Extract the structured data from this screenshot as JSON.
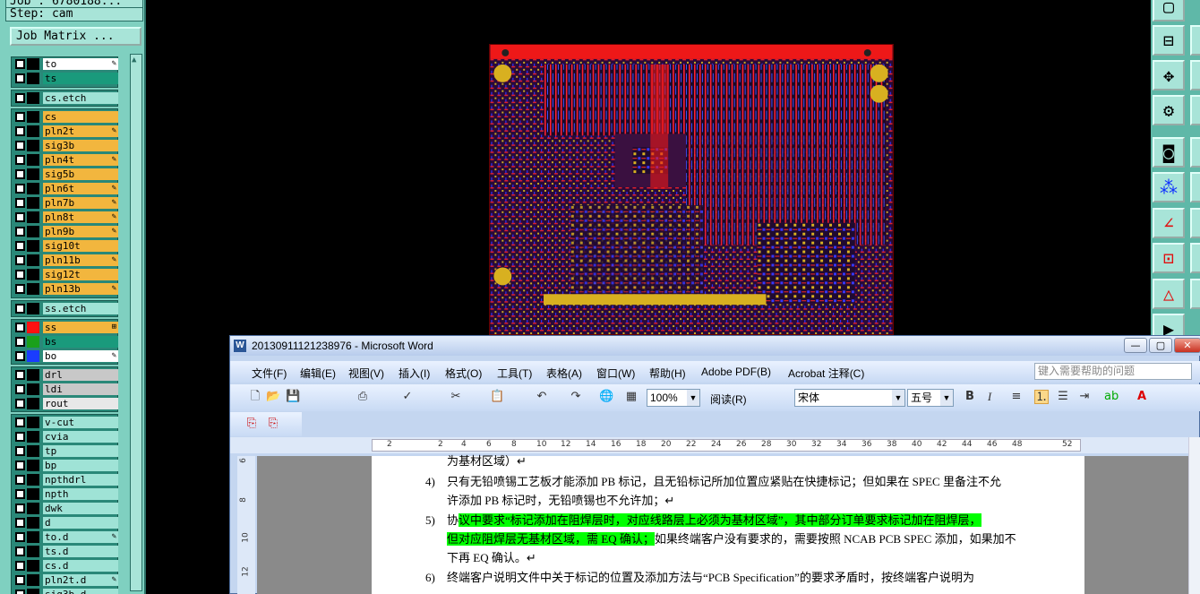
{
  "left_panel": {
    "header_top": "Job : 6780188...",
    "step": "Step: cam",
    "job_matrix_button": "Job Matrix ..."
  },
  "layers": [
    {
      "name": "to",
      "color": "#ffffff",
      "swatch": "#000000",
      "mark": "✎"
    },
    {
      "name": "ts",
      "color": "#1a9a7c",
      "swatch": "#000000",
      "mark": ""
    },
    {
      "name": "cs.etch",
      "color": "#9fe3d6",
      "swatch": "#000000",
      "mark": ""
    },
    {
      "name": "cs",
      "color": "#f2b63e",
      "swatch": "#000000",
      "mark": ""
    },
    {
      "name": "pln2t",
      "color": "#f2b63e",
      "swatch": "#000000",
      "mark": "✎"
    },
    {
      "name": "sig3b",
      "color": "#f2b63e",
      "swatch": "#000000",
      "mark": ""
    },
    {
      "name": "pln4t",
      "color": "#f2b63e",
      "swatch": "#000000",
      "mark": "✎"
    },
    {
      "name": "sig5b",
      "color": "#f2b63e",
      "swatch": "#000000",
      "mark": ""
    },
    {
      "name": "pln6t",
      "color": "#f2b63e",
      "swatch": "#000000",
      "mark": "✎"
    },
    {
      "name": "pln7b",
      "color": "#f2b63e",
      "swatch": "#000000",
      "mark": "✎"
    },
    {
      "name": "pln8t",
      "color": "#f2b63e",
      "swatch": "#000000",
      "mark": "✎"
    },
    {
      "name": "pln9b",
      "color": "#f2b63e",
      "swatch": "#000000",
      "mark": "✎"
    },
    {
      "name": "sig10t",
      "color": "#f2b63e",
      "swatch": "#000000",
      "mark": ""
    },
    {
      "name": "pln11b",
      "color": "#f2b63e",
      "swatch": "#000000",
      "mark": "✎"
    },
    {
      "name": "sig12t",
      "color": "#f2b63e",
      "swatch": "#000000",
      "mark": ""
    },
    {
      "name": "pln13b",
      "color": "#f2b63e",
      "swatch": "#000000",
      "mark": "✎"
    },
    {
      "name": "ss.etch",
      "color": "#9fe3d6",
      "swatch": "#000000",
      "mark": ""
    },
    {
      "name": "ss",
      "color": "#f2b63e",
      "swatch": "#ff1111",
      "mark": "⊞"
    },
    {
      "name": "bs",
      "color": "#1a9a7c",
      "swatch": "#1aa01a",
      "mark": ""
    },
    {
      "name": "bo",
      "color": "#ffffff",
      "swatch": "#1a3cff",
      "mark": "✎"
    },
    {
      "name": "drl",
      "color": "#c8c8c8",
      "swatch": "#000000",
      "mark": ""
    },
    {
      "name": "ldi",
      "color": "#c8c8c8",
      "swatch": "#000000",
      "mark": ""
    },
    {
      "name": "rout",
      "color": "#e8e8e8",
      "swatch": "#000000",
      "mark": ""
    },
    {
      "name": "v-cut",
      "color": "#9fe3d6",
      "swatch": "#000000",
      "mark": ""
    },
    {
      "name": "cvia",
      "color": "#9fe3d6",
      "swatch": "#000000",
      "mark": ""
    },
    {
      "name": "tp",
      "color": "#9fe3d6",
      "swatch": "#000000",
      "mark": ""
    },
    {
      "name": "bp",
      "color": "#9fe3d6",
      "swatch": "#000000",
      "mark": ""
    },
    {
      "name": "npthdrl",
      "color": "#9fe3d6",
      "swatch": "#000000",
      "mark": ""
    },
    {
      "name": "npth",
      "color": "#9fe3d6",
      "swatch": "#000000",
      "mark": ""
    },
    {
      "name": "dwk",
      "color": "#9fe3d6",
      "swatch": "#000000",
      "mark": ""
    },
    {
      "name": "d",
      "color": "#9fe3d6",
      "swatch": "#000000",
      "mark": ""
    },
    {
      "name": "to.d",
      "color": "#9fe3d6",
      "swatch": "#000000",
      "mark": "✎"
    },
    {
      "name": "ts.d",
      "color": "#9fe3d6",
      "swatch": "#000000",
      "mark": ""
    },
    {
      "name": "cs.d",
      "color": "#9fe3d6",
      "swatch": "#000000",
      "mark": ""
    },
    {
      "name": "pln2t.d",
      "color": "#9fe3d6",
      "swatch": "#000000",
      "mark": "✎"
    },
    {
      "name": "sig3b.d",
      "color": "#9fe3d6",
      "swatch": "#000000",
      "mark": ""
    }
  ],
  "word": {
    "title": "20130911121238976 - Microsoft Word",
    "menus": [
      "文件(F)",
      "编辑(E)",
      "视图(V)",
      "插入(I)",
      "格式(O)",
      "工具(T)",
      "表格(A)",
      "窗口(W)",
      "帮助(H)",
      "Adobe PDF(B)",
      "Acrobat 注释(C)"
    ],
    "help_placeholder": "键入需要帮助的问题",
    "zoom": "100%",
    "read_button": "阅读(R)",
    "font": "宋体",
    "font_size": "五号",
    "ruler_ticks": [
      "2",
      "2",
      "4",
      "6",
      "8",
      "10",
      "12",
      "14",
      "16",
      "18",
      "20",
      "22",
      "24",
      "26",
      "28",
      "30",
      "32",
      "34",
      "36",
      "38",
      "40",
      "42",
      "44",
      "46",
      "48",
      "52"
    ],
    "vruler_ticks": [
      "6",
      "8",
      "10",
      "12"
    ],
    "doc": {
      "line0": "为基材区域）↵",
      "n4": "4)",
      "line4a": "只有无铅喷锡工艺板才能添加 PB 标记，且无铅标记所加位置应紧贴在快捷标记；但如果在 SPEC 里备注不允",
      "line4b": "许添加 PB 标记时，无铅喷锡也不允许加；↵",
      "n5": "5)",
      "line5a_pre": "协",
      "line5a_hl": "议中要求“标记添加在阻焊层时，对应线路层上必须为基材区域”，其中部分订单要求标记加在阻焊层，",
      "line5b_hl": "但对应阻焊层无基材区域，需 EQ 确认；",
      "line5b_rest": "如果终端客户没有要求的，需要按照 NCAB PCB SPEC 添加，如果加不",
      "line5c": "下再 EQ 确认。↵",
      "n6": "6)",
      "line6a": "终端客户说明文件中关于标记的位置及添加方法与“PCB Specification”的要求矛盾时，按终端客户说明为"
    }
  }
}
